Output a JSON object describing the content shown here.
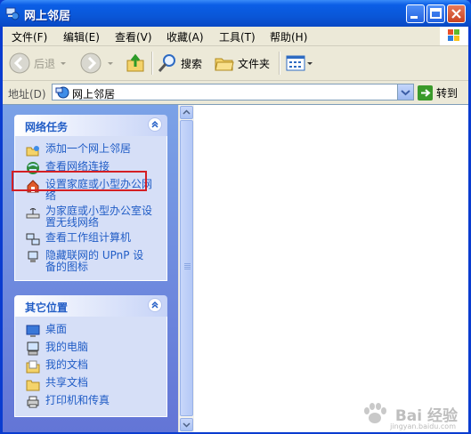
{
  "window": {
    "title": "网上邻居",
    "title_icon": "network-places-icon"
  },
  "menu": [
    "文件(F)",
    "编辑(E)",
    "查看(V)",
    "收藏(A)",
    "工具(T)",
    "帮助(H)"
  ],
  "toolbar": {
    "back": "后退",
    "search": "搜索",
    "folders": "文件夹"
  },
  "address": {
    "label": "地址(D)",
    "value": "网上邻居",
    "go": "转到"
  },
  "network_tasks": {
    "title": "网络任务",
    "items": [
      {
        "label": "添加一个网上邻居",
        "icon": "add-network-place-icon"
      },
      {
        "label": "查看网络连接",
        "icon": "network-connections-icon"
      },
      {
        "label": "设置家庭或小型办公网络",
        "icon": "home-network-setup-icon"
      },
      {
        "label": "为家庭或小型办公室设置无线网络",
        "icon": "wireless-setup-icon"
      },
      {
        "label": "查看工作组计算机",
        "icon": "workgroup-computers-icon"
      },
      {
        "label": "隐藏联网的 UPnP 设备的图标",
        "icon": "upnp-device-icon"
      }
    ]
  },
  "other_places": {
    "title": "其它位置",
    "items": [
      {
        "label": "桌面",
        "icon": "desktop-icon"
      },
      {
        "label": "我的电脑",
        "icon": "my-computer-icon"
      },
      {
        "label": "我的文档",
        "icon": "my-documents-icon"
      },
      {
        "label": "共享文档",
        "icon": "shared-documents-icon"
      },
      {
        "label": "打印机和传真",
        "icon": "printers-fax-icon"
      }
    ]
  },
  "watermark": {
    "text": "Bai 经验",
    "url": "jingyan.baidu.com"
  },
  "colors": {
    "link": "#215dc6",
    "title_bar": "#0a57d8",
    "highlight": "#d41f24"
  }
}
